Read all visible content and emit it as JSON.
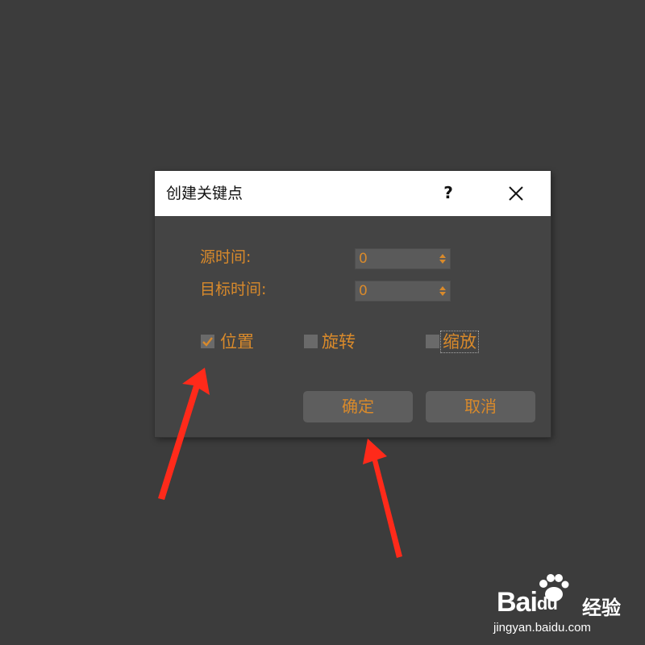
{
  "dialog": {
    "title": "创建关键点",
    "help_label": "?",
    "source_time_label": "源时间:",
    "source_time_value": "0",
    "target_time_label": "目标时间:",
    "target_time_value": "0",
    "checkboxes": [
      {
        "label": "位置",
        "checked": true
      },
      {
        "label": "旋转",
        "checked": false
      },
      {
        "label": "缩放",
        "checked": false
      }
    ],
    "ok_label": "确定",
    "cancel_label": "取消"
  },
  "watermark": {
    "logo": "Bai",
    "logo_du": "du",
    "suffix": "经验",
    "url": "jingyan.baidu.com"
  },
  "colors": {
    "background": "#3c3c3c",
    "dialog_body": "#444444",
    "accent_text": "#d98a2b",
    "annotation_arrow": "#ff2a1a"
  }
}
